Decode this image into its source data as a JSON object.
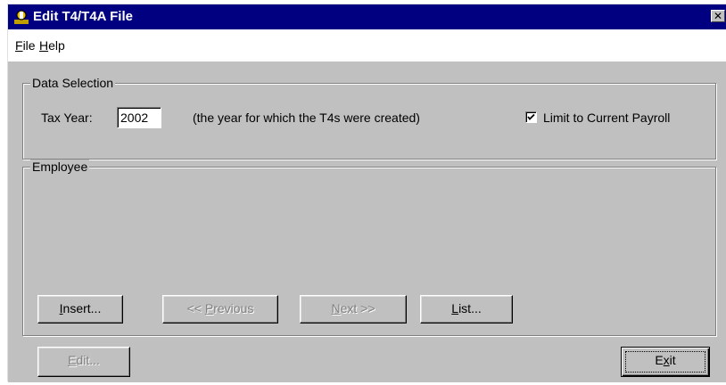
{
  "window": {
    "title": "Edit T4/T4A File",
    "close_symbol": "✕"
  },
  "menu": {
    "file": {
      "mnemonic": "F",
      "rest": "ile"
    },
    "help": {
      "mnemonic": "H",
      "rest": "elp"
    }
  },
  "data_selection": {
    "legend": "Data Selection",
    "tax_year_label": "Tax Year:",
    "tax_year_value": "2002",
    "tax_year_hint": "(the year for which the T4s were created)",
    "limit_label": "Limit to Current Payroll",
    "limit_checked": true
  },
  "employee": {
    "legend": "Employee",
    "insert": {
      "mnemonic": "I",
      "rest": "nsert..."
    },
    "previous": {
      "pre": "<< ",
      "mnemonic": "P",
      "rest": "revious"
    },
    "next": {
      "mnemonic": "N",
      "rest": "ext >>"
    },
    "list": {
      "mnemonic": "L",
      "rest": "ist..."
    }
  },
  "footer": {
    "edit": {
      "mnemonic": "E",
      "rest": "dit..."
    },
    "exit": {
      "pre": "E",
      "mnemonic": "x",
      "rest": "it"
    }
  },
  "colors": {
    "titlebar": "#000080",
    "face": "#c0c0c0",
    "disabled_text": "#808080"
  },
  "icons": {
    "app": "payroll-app-icon",
    "close": "close-icon",
    "check": "checkmark-icon"
  }
}
